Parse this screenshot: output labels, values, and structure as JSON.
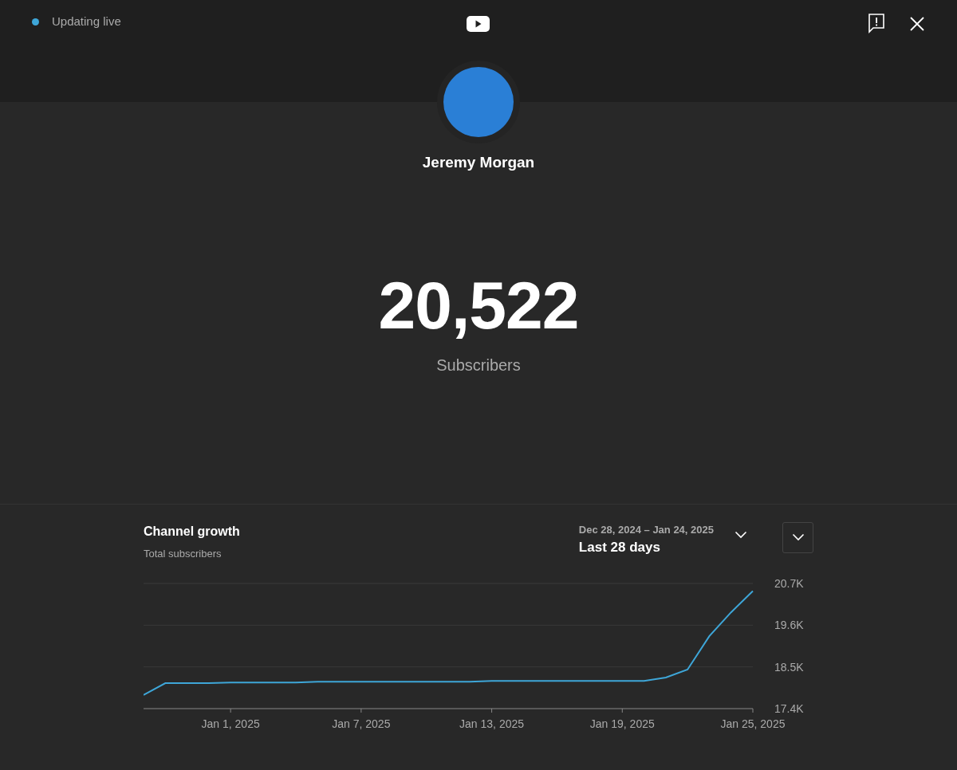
{
  "status": {
    "label": "Updating live",
    "live": true
  },
  "channel": {
    "name": "Jeremy Morgan"
  },
  "counter": {
    "value": "20,522",
    "label": "Subscribers"
  },
  "growth": {
    "title": "Channel growth",
    "subtitle": "Total subscribers",
    "date_range": "Dec 28, 2024 – Jan 24, 2025",
    "period": "Last 28 days",
    "chart_data": {
      "type": "line",
      "categories": [
        null,
        null,
        null,
        null,
        "Jan 1, 2025",
        null,
        null,
        null,
        null,
        null,
        "Jan 7, 2025",
        null,
        null,
        null,
        null,
        null,
        "Jan 13, 2025",
        null,
        null,
        null,
        null,
        null,
        "Jan 19, 2025",
        null,
        null,
        null,
        null,
        null,
        "Jan 25, 2025"
      ],
      "series": [
        {
          "color": "#3ea6d8",
          "values": [
            17760,
            18070,
            18070,
            18070,
            18090,
            18090,
            18090,
            18090,
            18110,
            18110,
            18110,
            18110,
            18110,
            18110,
            18110,
            18110,
            18130,
            18130,
            18130,
            18130,
            18130,
            18130,
            18130,
            18130,
            18220,
            18430,
            19310,
            19940,
            20500
          ]
        }
      ],
      "ylim": [
        17400,
        20700
      ],
      "yticks": [
        {
          "value": 17400,
          "label": "17.4K"
        },
        {
          "value": 18500,
          "label": "18.5K"
        },
        {
          "value": 19600,
          "label": "19.6K"
        },
        {
          "value": 20700,
          "label": "20.7K"
        }
      ]
    }
  }
}
